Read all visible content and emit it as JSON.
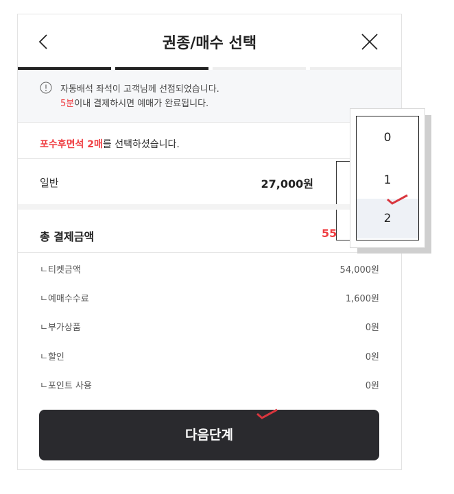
{
  "header": {
    "title": "권종/매수 선택"
  },
  "notice": {
    "line1": "자동배석 좌석이 고객님께 선점되었습니다.",
    "line2_highlight": "5분",
    "line2_rest": "이내 결제하시면 예매가 완료됩니다."
  },
  "selection": {
    "highlight": "포수후면석 2매",
    "rest": "를 선택하셨습니다."
  },
  "ticket": {
    "label": "일반",
    "price": "27,000원"
  },
  "total": {
    "label": "총 결제금액",
    "value_visible": "55"
  },
  "breakdown": [
    {
      "label": "ㄴ티켓금액",
      "value": "54,000원"
    },
    {
      "label": "ㄴ예매수수료",
      "value": "1,600원"
    },
    {
      "label": "ㄴ부가상품",
      "value": "0원"
    },
    {
      "label": "ㄴ할인",
      "value": "0원"
    },
    {
      "label": "ㄴ포인트 사용",
      "value": "0원"
    }
  ],
  "next_button": {
    "label": "다음단계"
  },
  "quantity_dropdown": {
    "options": [
      "0",
      "1",
      "2"
    ],
    "selected": "2"
  },
  "colors": {
    "accent_red": "#ef3e42",
    "button_dark": "#2a2a2e",
    "step_active": "#222222",
    "step_inactive": "#eeeeee"
  },
  "icons": {
    "back": "chevron-left-icon",
    "close": "close-icon",
    "notice": "exclamation-circle-icon",
    "check": "check-icon"
  }
}
